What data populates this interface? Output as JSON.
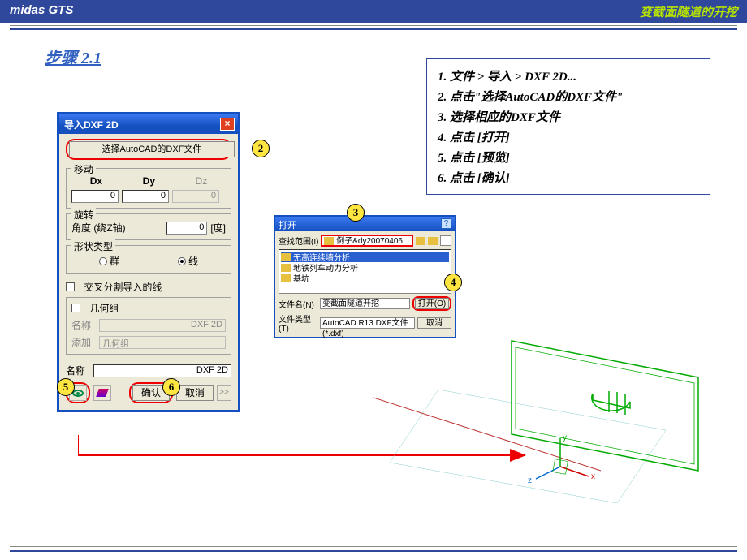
{
  "header": {
    "left": "midas GTS",
    "right": "变截面隧道的开挖"
  },
  "step": {
    "pre": "步骤 ",
    "num": "2.1"
  },
  "instructions": [
    {
      "t1": "文件 > 导入 > ",
      "en": "DXF 2D..."
    },
    {
      "t1": "点击\"选择",
      "en": "AutoCAD",
      "t2": "的",
      "en2": "DXF",
      "t3": "文件\""
    },
    {
      "t1": "选择相应的",
      "en": "DXF",
      "t2": "文件"
    },
    {
      "t1": "点击 [打开]"
    },
    {
      "t1": "点击 [预览]"
    },
    {
      "t1": "点击 [确认]"
    }
  ],
  "dlg": {
    "title": "导入DXF 2D",
    "selectBtn": "选择AutoCAD的DXF文件",
    "moveGroup": "移动",
    "dx": "Dx",
    "dy": "Dy",
    "dz": "Dz",
    "dxVal": "0",
    "dyVal": "0",
    "dzVal": "0",
    "rotGroup": "旋转",
    "rotLabel": "角度 (绕Z轴)",
    "rotVal": "0",
    "rotUnit": "[度]",
    "shapeGroup": "形状类型",
    "shapeGroup2": "群",
    "shapeLine": "线",
    "crossChk": "交叉分割导入的线",
    "geomChk": "几何组",
    "nameLbl": "名称",
    "nameVal": "DXF 2D",
    "addLbl": "添加",
    "addVal": "几何组",
    "nameLbl2": "名称",
    "nameVal2": "DXF 2D",
    "ok": "确认",
    "cancel": "取消",
    "more": ">>"
  },
  "open": {
    "title": "打开",
    "lookIn": "查找范围(I)",
    "folder": "例子&dy20070406",
    "items": [
      "无高连续墙分析",
      "地铁列车动力分析",
      "基坑"
    ],
    "fn": "文件名(N)",
    "fnVal": "变截面隧道开挖",
    "ft": "文件类型(T)",
    "ftVal": "AutoCAD R13 DXF文件(*.dxf)",
    "openBtn": "打开(O)",
    "cancelBtn": "取消"
  },
  "callouts": {
    "c2": "2",
    "c3": "3",
    "c4": "4",
    "c5": "5",
    "c6": "6"
  }
}
